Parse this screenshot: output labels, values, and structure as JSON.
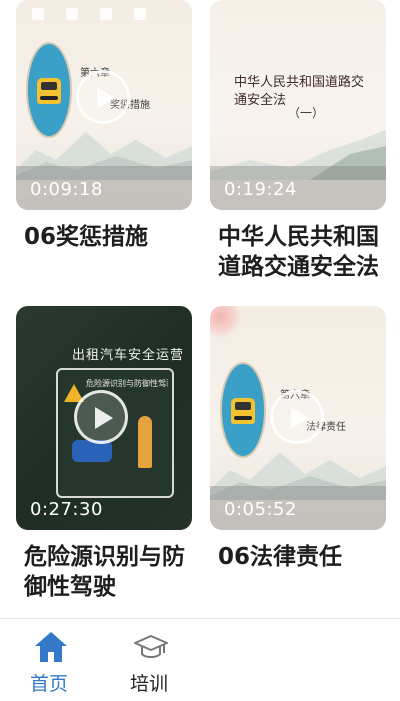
{
  "videos": [
    {
      "title": "06奖惩措施",
      "duration": "0:09:18",
      "slide_heading": "第六章",
      "slide_subtitle": "奖惩措施"
    },
    {
      "title": "中华人民共和国道路交通安全法",
      "duration": "0:19:24",
      "slide_heading": "中华人民共和国道路交通安全法",
      "slide_subtitle": "（一）"
    },
    {
      "title": "危险源识别与防御性驾驶",
      "duration": "0:27:30",
      "slide_heading": "出租汽车安全运营",
      "slide_subtitle": "危险源识别与防御性驾驶"
    },
    {
      "title": "06法律责任",
      "duration": "0:05:52",
      "slide_heading": "第六章",
      "slide_subtitle": "法律责任"
    }
  ],
  "tabbar": {
    "items": [
      {
        "label": "首页",
        "icon": "home-icon",
        "active": true
      },
      {
        "label": "培训",
        "icon": "graduation-cap-icon",
        "active": false
      }
    ]
  },
  "colors": {
    "active_tab": "#3478c8",
    "inactive_tab": "#222222",
    "title_text": "#1e1e1e"
  }
}
